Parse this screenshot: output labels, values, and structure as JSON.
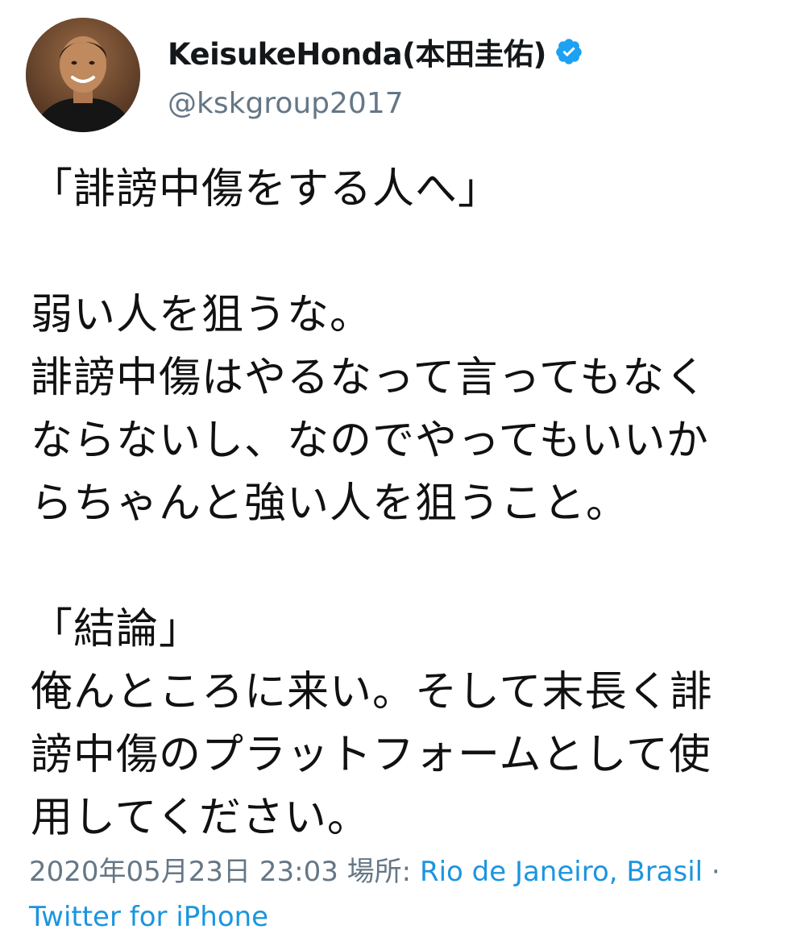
{
  "author": {
    "display_name": "KeisukeHonda(本田圭佑)",
    "handle": "@kskgroup2017",
    "verified_icon": "verified-badge-icon",
    "avatar_icon": "profile-photo"
  },
  "tweet": {
    "lines": [
      "「誹謗中傷をする人へ」",
      "",
      "弱い人を狙うな。",
      "誹謗中傷はやるなって言ってもなく",
      "ならないし、なのでやってもいいか",
      "らちゃんと強い人を狙うこと。",
      "",
      "「結論」",
      "俺んところに来い。そして末長く誹",
      "謗中傷のプラットフォームとして使",
      "用してください。"
    ]
  },
  "meta": {
    "timestamp": "2020年05月23日 23:03",
    "location_label": "場所:",
    "location": "Rio de Janeiro, Brasil",
    "separator": "·",
    "source": "Twitter for iPhone"
  },
  "colors": {
    "link": "#1b95e0",
    "secondary_text": "#657786",
    "verified": "#1da1f2",
    "text": "#111111"
  }
}
